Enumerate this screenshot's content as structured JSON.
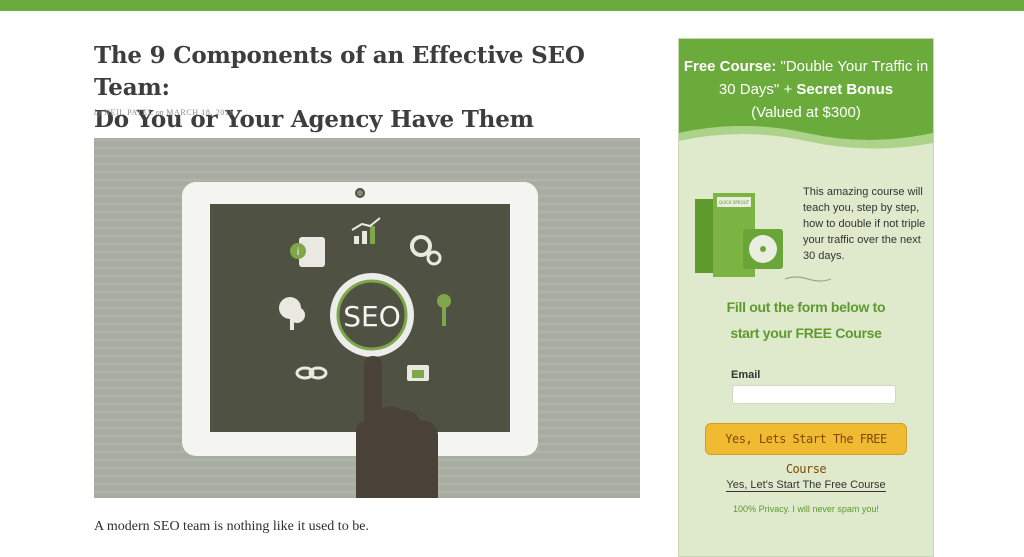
{
  "article": {
    "title_line1": "The 9 Components of an Effective SEO Team:",
    "title_line2": "Do You or Your Agency Have Them Covered?",
    "byline_by": "by",
    "author": "NEIL PATEL",
    "byline_on": "on",
    "date": "MARCH 18, 2016",
    "hero_text": "SEO",
    "caption": "A modern SEO team is nothing like it used to be."
  },
  "sidebar": {
    "head_prefix": "Free Course:",
    "head_title": "\"Double Your Traffic in 30 Days\"",
    "head_plus": "+",
    "head_bonus": "Secret Bonus",
    "head_value": "(Valued at $300)",
    "promo": "This amazing course will teach you, step by step, how to double if not triple your traffic over the next 30 days.",
    "cta_line1": "Fill out the form below to",
    "cta_line2": "start your FREE Course",
    "email_label": "Email",
    "email_value": "",
    "submit_label": "Yes, Lets Start The FREE Course",
    "text_link": "Yes, Let's Start The Free Course",
    "privacy": "100% Privacy. I will never spam you!",
    "product_label": "QUICK SPROUT"
  },
  "colors": {
    "accent": "#6aab3c",
    "sidebar_bg": "#dfe9cc",
    "button": "#f0bb33"
  }
}
